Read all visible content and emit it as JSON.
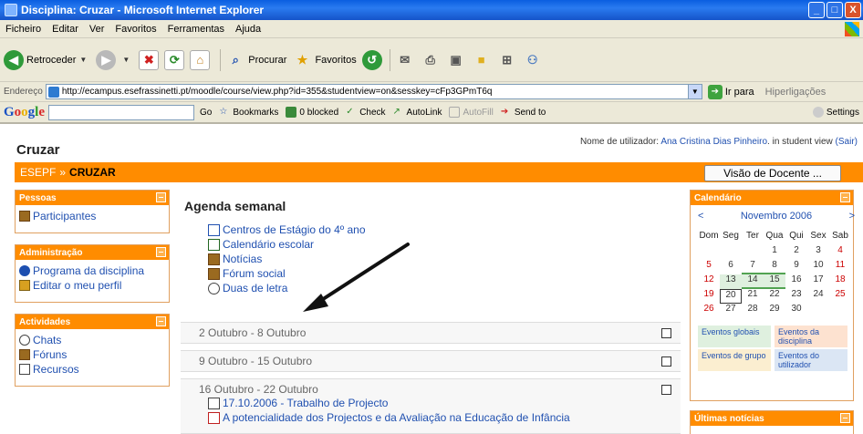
{
  "window": {
    "title": "Disciplina: Cruzar - Microsoft Internet Explorer",
    "btn_min": "_",
    "btn_max": "□",
    "btn_close": "X"
  },
  "menu": [
    "Ficheiro",
    "Editar",
    "Ver",
    "Favoritos",
    "Ferramentas",
    "Ajuda"
  ],
  "toolbar": {
    "back": "Retroceder",
    "search": "Procurar",
    "favorites": "Favoritos"
  },
  "address": {
    "label": "Endereço",
    "url": "http://ecampus.esefrassinetti.pt/moodle/course/view.php?id=355&studentview=on&sesskey=cFp3GPmT6q",
    "go": "Ir para",
    "links": "Hiperligações"
  },
  "googlebar": {
    "logo": "Google",
    "go": "Go",
    "bookmarks": "Bookmarks",
    "blocked": "0 blocked",
    "check": "Check",
    "autolink": "AutoLink",
    "autofill": "AutoFill",
    "sendto": "Send to",
    "settings": "Settings"
  },
  "course": {
    "title": "Cruzar",
    "login_prefix": "Nome de utilizador:",
    "login_name": "Ana Cristina Dias Pinheiro",
    "login_suffix": ". in student view",
    "logout": "(Sair)",
    "crumb_site": "ESEPF",
    "crumb_sep": "»",
    "crumb_course": "CRUZAR",
    "teacher_view": "Visão de Docente ..."
  },
  "blocks": {
    "people": {
      "title": "Pessoas",
      "items": [
        "Participantes"
      ]
    },
    "admin": {
      "title": "Administração",
      "items": [
        "Programa da disciplina",
        "Editar o meu perfil"
      ]
    },
    "activities": {
      "title": "Actividades",
      "items": [
        "Chats",
        "Fóruns",
        "Recursos"
      ]
    }
  },
  "main": {
    "heading": "Agenda semanal",
    "topic0": [
      "Centros de Estágio do 4º ano",
      "Calendário escolar",
      "Notícias",
      "Fórum social",
      "Duas de letra"
    ],
    "weeks": [
      {
        "title": "2 Outubro - 8 Outubro",
        "items": []
      },
      {
        "title": "9 Outubro - 15 Outubro",
        "items": []
      },
      {
        "title": "16 Outubro - 22 Outubro",
        "items": [
          "17.10.2006 - Trabalho de Projecto",
          "A potencialidade dos Projectos e da Avaliação na Educação de Infância"
        ]
      }
    ]
  },
  "calendar": {
    "title": "Calendário",
    "prev": "<",
    "next": ">",
    "month": "Novembro 2006",
    "days": [
      "Dom",
      "Seg",
      "Ter",
      "Qua",
      "Qui",
      "Sex",
      "Sab"
    ],
    "weeks": [
      [
        "",
        "",
        "",
        "1",
        "2",
        "3",
        "4"
      ],
      [
        "5",
        "6",
        "7",
        "8",
        "9",
        "10",
        "11"
      ],
      [
        "12",
        "13",
        "14",
        "15",
        "16",
        "17",
        "18"
      ],
      [
        "19",
        "20",
        "21",
        "22",
        "23",
        "24",
        "25"
      ],
      [
        "26",
        "27",
        "28",
        "29",
        "30",
        "",
        ""
      ]
    ],
    "legend": [
      "Eventos globais",
      "Eventos da disciplina",
      "Eventos de grupo",
      "Eventos do utilizador"
    ]
  },
  "news": {
    "title": "Últimas notícias"
  },
  "colors": {
    "accent": "#ff8c00",
    "link": "#2050b0",
    "titlebar": "#0a5ee0"
  }
}
